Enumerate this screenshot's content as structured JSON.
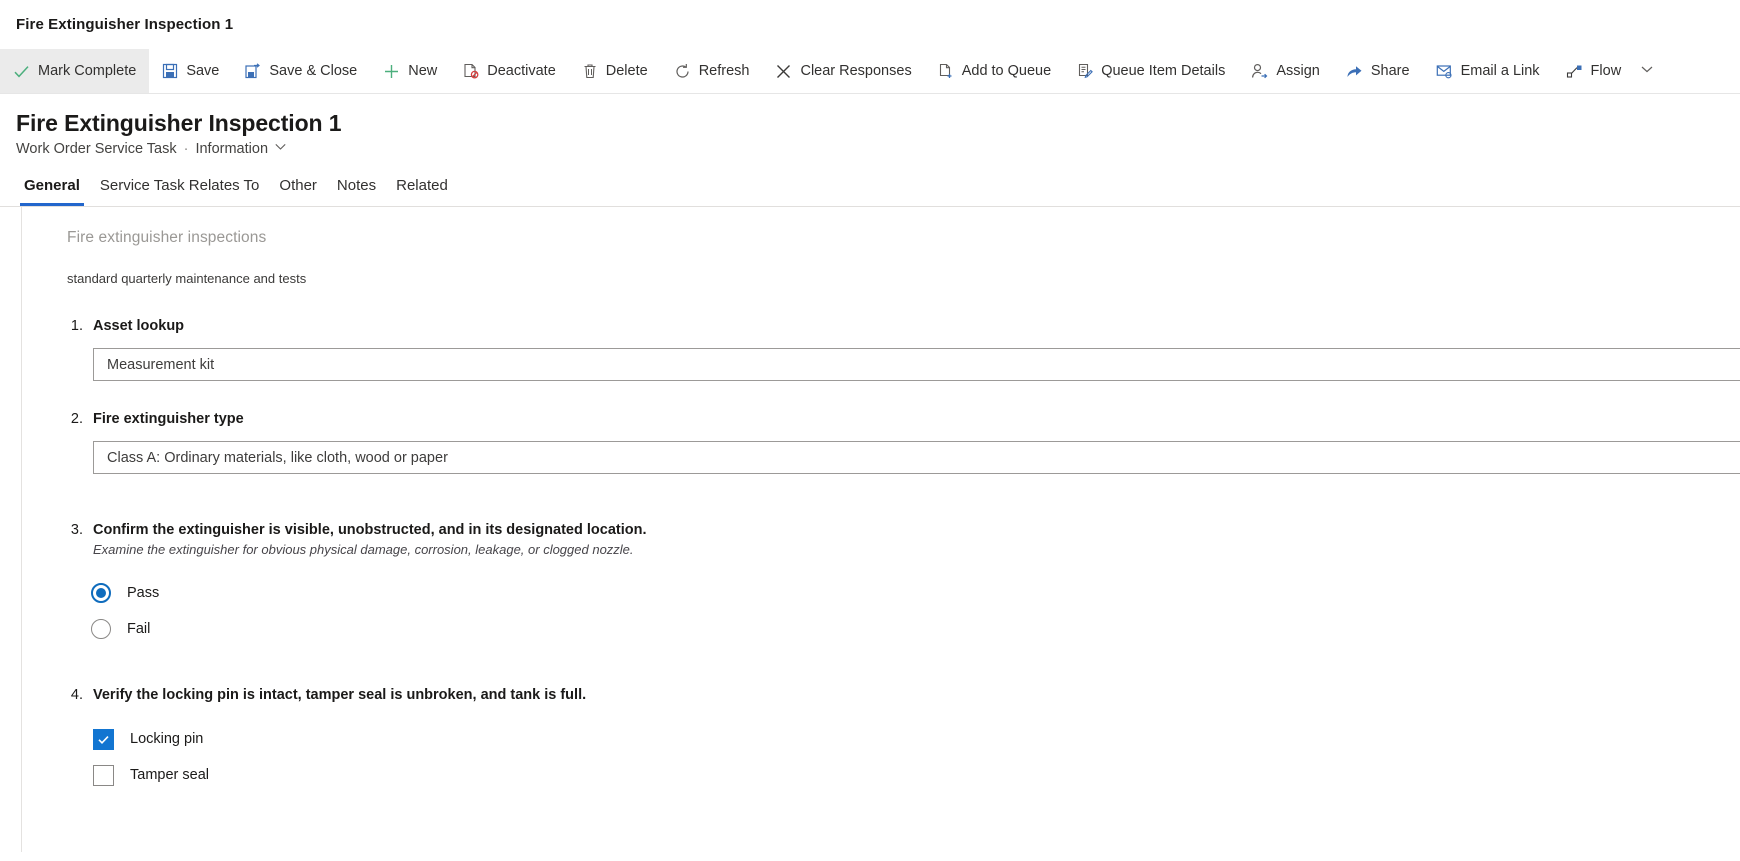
{
  "window": {
    "title": "Fire Extinguisher Inspection 1"
  },
  "commandbar": {
    "items": [
      {
        "label": "Mark Complete",
        "icon": "checkmark-icon",
        "highlight": true
      },
      {
        "label": "Save",
        "icon": "save-icon",
        "highlight": false
      },
      {
        "label": "Save & Close",
        "icon": "save-close-icon",
        "highlight": false
      },
      {
        "label": "New",
        "icon": "plus-icon",
        "highlight": false
      },
      {
        "label": "Deactivate",
        "icon": "deactivate-icon",
        "highlight": false
      },
      {
        "label": "Delete",
        "icon": "trash-icon",
        "highlight": false
      },
      {
        "label": "Refresh",
        "icon": "refresh-icon",
        "highlight": false
      },
      {
        "label": "Clear Responses",
        "icon": "close-x-icon",
        "highlight": false
      },
      {
        "label": "Add to Queue",
        "icon": "add-to-queue-icon",
        "highlight": false
      },
      {
        "label": "Queue Item Details",
        "icon": "queue-item-details-icon",
        "highlight": false
      },
      {
        "label": "Assign",
        "icon": "assign-person-icon",
        "highlight": false
      },
      {
        "label": "Share",
        "icon": "share-icon",
        "highlight": false
      },
      {
        "label": "Email a Link",
        "icon": "email-link-icon",
        "highlight": false
      },
      {
        "label": "Flow",
        "icon": "flow-icon",
        "highlight": false
      }
    ],
    "overflow_icon": "chevron-down-icon"
  },
  "record": {
    "title": "Fire Extinguisher Inspection 1",
    "entity": "Work Order Service Task",
    "separator": "·",
    "form_name": "Information",
    "form_chevron_icon": "chevron-down-icon"
  },
  "tabs": [
    {
      "label": "General",
      "active": true
    },
    {
      "label": "Service Task Relates To",
      "active": false
    },
    {
      "label": "Other",
      "active": false
    },
    {
      "label": "Notes",
      "active": false
    },
    {
      "label": "Related",
      "active": false
    }
  ],
  "form": {
    "section_title": "Fire extinguisher inspections",
    "section_description": "standard quarterly maintenance and tests",
    "questions": [
      {
        "number": "1.",
        "label": "Asset lookup",
        "type": "text",
        "value": "Measurement kit"
      },
      {
        "number": "2.",
        "label": "Fire extinguisher type",
        "type": "text",
        "value": "Class A: Ordinary materials, like cloth, wood or paper"
      },
      {
        "number": "3.",
        "label": "Confirm the extinguisher is visible, unobstructed, and in its designated location.",
        "hint": "Examine the extinguisher for obvious physical damage, corrosion, leakage, or clogged nozzle.",
        "type": "radio",
        "options": [
          {
            "label": "Pass",
            "selected": true
          },
          {
            "label": "Fail",
            "selected": false
          }
        ]
      },
      {
        "number": "4.",
        "label": "Verify the locking pin is intact, tamper seal is unbroken, and tank is full.",
        "type": "checkbox",
        "options": [
          {
            "label": "Locking pin",
            "checked": true
          },
          {
            "label": "Tamper seal",
            "checked": false
          }
        ]
      }
    ]
  },
  "colors": {
    "accent": "#2266cc",
    "control_blue": "#1275d1",
    "radio_blue": "#0f6cbd",
    "success_green": "#4caf7d",
    "highlight_gray": "#ebebeb"
  }
}
